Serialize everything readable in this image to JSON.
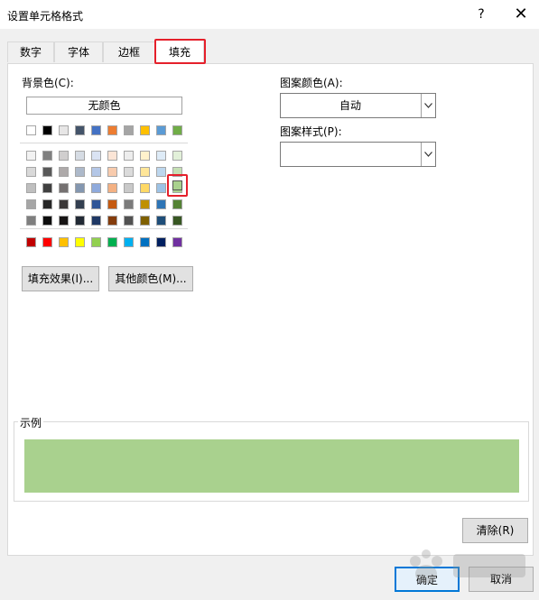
{
  "window": {
    "title": "设置单元格格式",
    "help_glyph": "?",
    "close_glyph": "✕"
  },
  "tabs": [
    {
      "label": "数字"
    },
    {
      "label": "字体"
    },
    {
      "label": "边框"
    },
    {
      "label": "填充",
      "active": true
    }
  ],
  "fill": {
    "background_label": "背景色(C):",
    "no_color_label": "无颜色",
    "fill_effects_label": "填充效果(I)...",
    "more_colors_label": "其他颜色(M)...",
    "pattern_color_label": "图案颜色(A):",
    "pattern_color_value": "自动",
    "pattern_style_label": "图案样式(P):",
    "pattern_style_value": ""
  },
  "palette": {
    "theme_top": [
      "#ffffff",
      "#000000",
      "#e7e6e6",
      "#44546a",
      "#4472c4",
      "#ed7d31",
      "#a5a5a5",
      "#ffc000",
      "#5b9bd5",
      "#70ad47"
    ],
    "theme_shades": [
      [
        "#f2f2f2",
        "#808080",
        "#d0cece",
        "#d6dce4",
        "#dae3f3",
        "#fbe5d6",
        "#ededed",
        "#fff2cc",
        "#deebf7",
        "#e2f0d9"
      ],
      [
        "#d9d9d9",
        "#595959",
        "#aeaaaa",
        "#adb9ca",
        "#b4c7e7",
        "#f8cbad",
        "#dbdbdb",
        "#ffe699",
        "#bdd7ee",
        "#c5e0b4"
      ],
      [
        "#bfbfbf",
        "#404040",
        "#757171",
        "#8497b0",
        "#8faadc",
        "#f4b183",
        "#c9c9c9",
        "#ffd966",
        "#9dc3e6",
        "#a9d18e"
      ],
      [
        "#a6a6a6",
        "#262626",
        "#3b3838",
        "#333f50",
        "#2f5597",
        "#c55a11",
        "#7b7b7b",
        "#bf9000",
        "#2e75b6",
        "#548235"
      ],
      [
        "#7f7f7f",
        "#0d0d0d",
        "#171515",
        "#222a35",
        "#1f3864",
        "#843c0c",
        "#525252",
        "#7f6000",
        "#1f4e79",
        "#385723"
      ]
    ],
    "standard": [
      "#c00000",
      "#ff0000",
      "#ffc000",
      "#ffff00",
      "#92d050",
      "#00b050",
      "#00b0f0",
      "#0070c0",
      "#002060",
      "#7030a0"
    ],
    "selected_color": "#a9d18e"
  },
  "sample": {
    "label": "示例",
    "color": "#a9d18e"
  },
  "buttons": {
    "clear_label": "清除(R)",
    "ok_label": "确定",
    "cancel_label": "取消"
  },
  "accent": "#e5202b"
}
